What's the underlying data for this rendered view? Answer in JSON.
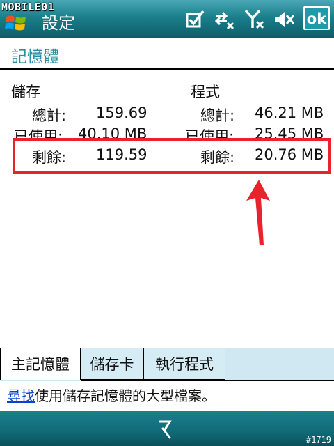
{
  "titlebar": {
    "watermark": "MOBILE01",
    "title": "設定",
    "ok_label": "ok"
  },
  "page": {
    "heading": "記憶體"
  },
  "storage": {
    "header": "儲存",
    "total_label": "總計:",
    "total_value": "159.69",
    "used_label": "已使用:",
    "used_value": "40.10 MB",
    "free_label": "剩餘:",
    "free_value": "119.59"
  },
  "program": {
    "header": "程式",
    "total_label": "總計:",
    "total_value": "46.21 MB",
    "used_label": "已使用:",
    "used_value": "25.45 MB",
    "free_label": "剩餘:",
    "free_value": "20.76 MB"
  },
  "tabs": [
    {
      "label": "主記憶體",
      "active": true
    },
    {
      "label": "儲存卡",
      "active": false
    },
    {
      "label": "執行程式",
      "active": false
    }
  ],
  "find": {
    "link": "尋找",
    "text": "使用儲存記憶體的大型檔案。"
  },
  "footer": {
    "stamp": "#1719"
  },
  "colors": {
    "accent": "#2a8ea0",
    "highlight": "#e8232b"
  },
  "icons": [
    "windows-start-icon",
    "checkbox-icon",
    "connectivity-icon",
    "signal-off-icon",
    "volume-off-icon",
    "keyboard-icon",
    "red-arrow-icon"
  ]
}
